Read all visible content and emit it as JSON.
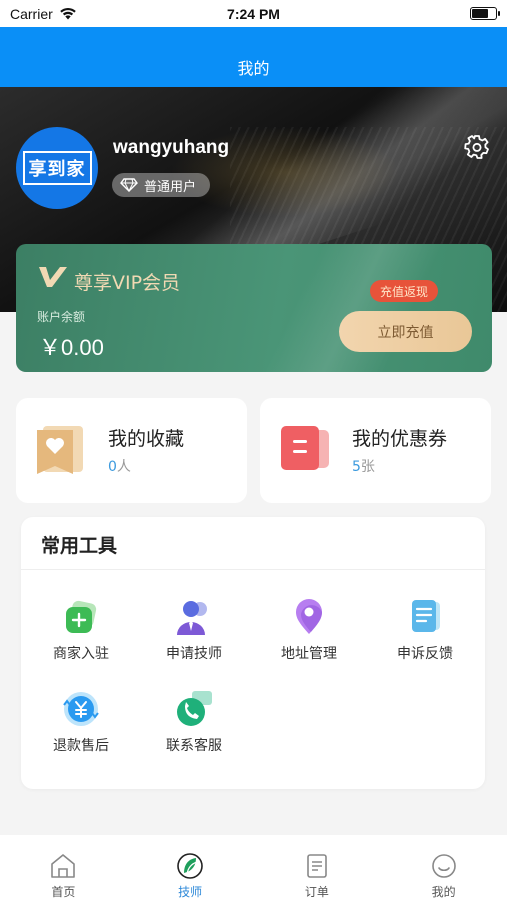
{
  "status_bar": {
    "carrier": "Carrier",
    "time": "7:24 PM"
  },
  "nav": {
    "title": "我的"
  },
  "profile": {
    "avatar_text": "享到家",
    "username": "wangyuhang",
    "badge": "普通用户"
  },
  "vip": {
    "title": "尊享VIP会员",
    "balance_label": "账户余额",
    "balance_value": "￥0.00",
    "tag": "充值返现",
    "button": "立即充值"
  },
  "quick": {
    "favorites": {
      "title": "我的收藏",
      "count": "0",
      "unit": "人"
    },
    "coupons": {
      "title": "我的优惠券",
      "count": "5",
      "unit": "张"
    }
  },
  "tools": {
    "title": "常用工具",
    "items": [
      {
        "label": "商家入驻",
        "icon": "merchant-icon"
      },
      {
        "label": "申请技师",
        "icon": "technician-icon"
      },
      {
        "label": "地址管理",
        "icon": "location-icon"
      },
      {
        "label": "申诉反馈",
        "icon": "feedback-icon"
      },
      {
        "label": "退款售后",
        "icon": "refund-icon"
      },
      {
        "label": "联系客服",
        "icon": "customer-service-icon"
      }
    ]
  },
  "tabs": [
    {
      "label": "首页",
      "icon": "home-icon",
      "active": false
    },
    {
      "label": "技师",
      "icon": "technician-tab-icon",
      "active": true
    },
    {
      "label": "订单",
      "icon": "order-icon",
      "active": false
    },
    {
      "label": "我的",
      "icon": "profile-icon",
      "active": false
    }
  ],
  "colors": {
    "nav_blue": "#0a8ff7",
    "vip_green": "#4a9577",
    "gold": "#e9c797",
    "accent_red": "#e7533a",
    "active_tab": "#2e89d8"
  }
}
